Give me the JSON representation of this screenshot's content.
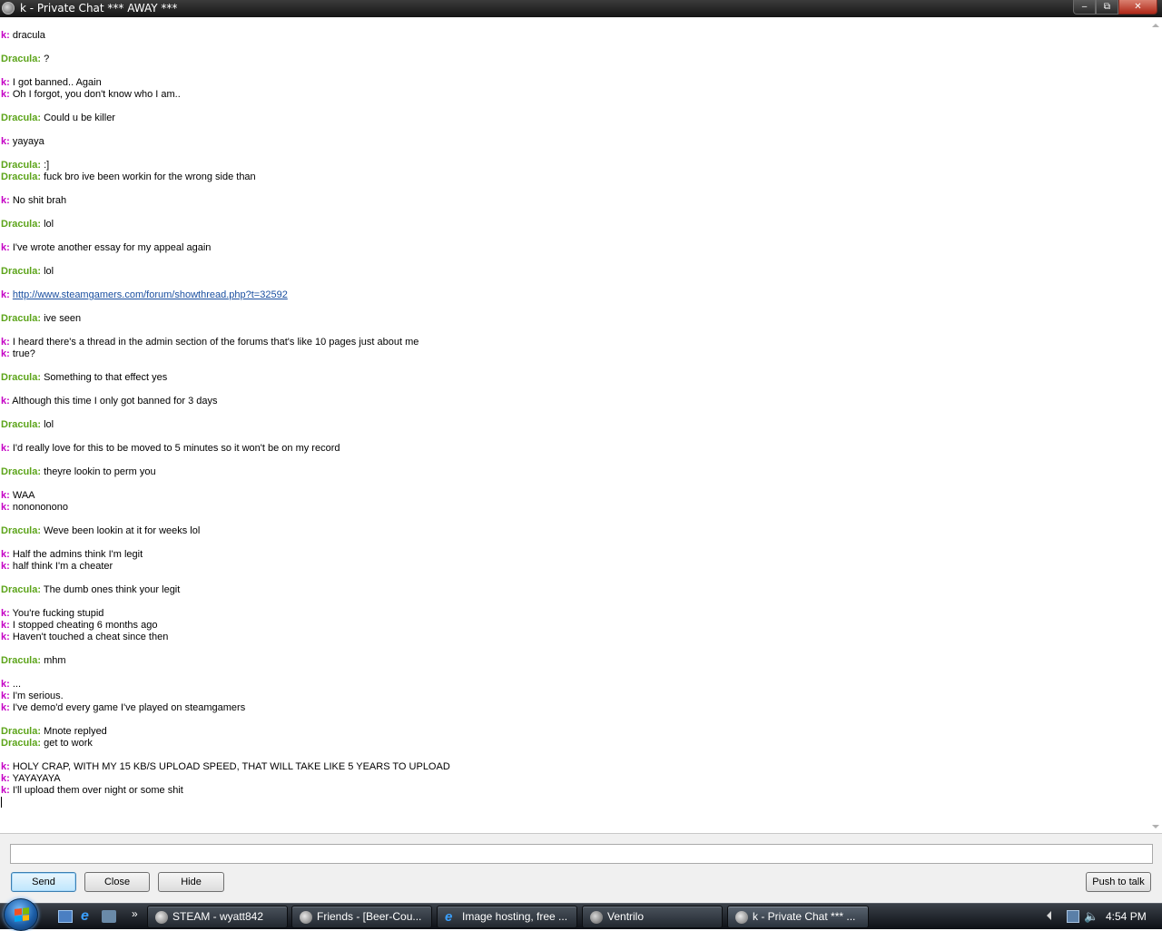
{
  "window": {
    "title": "k - Private Chat *** AWAY ***",
    "controls": {
      "minimize": "‒",
      "maximize": "⧉",
      "close": "✕"
    }
  },
  "colors": {
    "k": "#c400c4",
    "dracula": "#5ca41a",
    "link": "#1a4fa0"
  },
  "chat": {
    "messages": [
      {
        "speaker": "k:",
        "who": "k",
        "text": "dracula",
        "gap_before": false
      },
      {
        "speaker": "Dracula:",
        "who": "dracula",
        "text": "?",
        "gap_before": true
      },
      {
        "speaker": "k:",
        "who": "k",
        "text": "I got banned.. Again",
        "gap_before": true
      },
      {
        "speaker": "k:",
        "who": "k",
        "text": "Oh I forgot, you don't know who I am..",
        "gap_before": false
      },
      {
        "speaker": "Dracula:",
        "who": "dracula",
        "text": "Could u be killer",
        "gap_before": true
      },
      {
        "speaker": "k:",
        "who": "k",
        "text": "yayaya",
        "gap_before": true
      },
      {
        "speaker": "Dracula:",
        "who": "dracula",
        "text": ":]",
        "gap_before": true
      },
      {
        "speaker": "Dracula:",
        "who": "dracula",
        "text": "fuck bro ive been workin for the wrong side than",
        "gap_before": false
      },
      {
        "speaker": "k:",
        "who": "k",
        "text": "No shit brah",
        "gap_before": true
      },
      {
        "speaker": "Dracula:",
        "who": "dracula",
        "text": "lol",
        "gap_before": true
      },
      {
        "speaker": "k:",
        "who": "k",
        "text": "I've wrote another essay for my appeal again",
        "gap_before": true
      },
      {
        "speaker": "Dracula:",
        "who": "dracula",
        "text": "lol",
        "gap_before": true
      },
      {
        "speaker": "k:",
        "who": "k",
        "text": "http://www.steamgamers.com/forum/showthread.php?t=32592",
        "gap_before": true,
        "link": true
      },
      {
        "speaker": "Dracula:",
        "who": "dracula",
        "text": "ive seen",
        "gap_before": true
      },
      {
        "speaker": "k:",
        "who": "k",
        "text": "I heard there's a thread in the admin section of the forums that's like 10 pages just about me",
        "gap_before": true
      },
      {
        "speaker": "k:",
        "who": "k",
        "text": "true?",
        "gap_before": false
      },
      {
        "speaker": "Dracula:",
        "who": "dracula",
        "text": "Something to that effect yes",
        "gap_before": true
      },
      {
        "speaker": "k:",
        "who": "k",
        "text": "Although this time I only got banned for 3 days",
        "gap_before": true
      },
      {
        "speaker": "Dracula:",
        "who": "dracula",
        "text": "lol",
        "gap_before": true
      },
      {
        "speaker": "k:",
        "who": "k",
        "text": "I'd really love for this to be moved to 5 minutes so it won't be on my record",
        "gap_before": true
      },
      {
        "speaker": "Dracula:",
        "who": "dracula",
        "text": "theyre lookin to perm you",
        "gap_before": true
      },
      {
        "speaker": "k:",
        "who": "k",
        "text": "WAA",
        "gap_before": true
      },
      {
        "speaker": "k:",
        "who": "k",
        "text": "nonononono",
        "gap_before": false
      },
      {
        "speaker": "Dracula:",
        "who": "dracula",
        "text": "Weve been lookin at it for weeks lol",
        "gap_before": true
      },
      {
        "speaker": "k:",
        "who": "k",
        "text": "Half the admins think I'm legit",
        "gap_before": true
      },
      {
        "speaker": "k:",
        "who": "k",
        "text": "half think I'm a cheater",
        "gap_before": false
      },
      {
        "speaker": "Dracula:",
        "who": "dracula",
        "text": "The dumb ones think your legit",
        "gap_before": true
      },
      {
        "speaker": "k:",
        "who": "k",
        "text": "You're fucking stupid",
        "gap_before": true
      },
      {
        "speaker": "k:",
        "who": "k",
        "text": "I stopped cheating 6 months ago",
        "gap_before": false
      },
      {
        "speaker": "k:",
        "who": "k",
        "text": "Haven't touched a cheat since then",
        "gap_before": false
      },
      {
        "speaker": "Dracula:",
        "who": "dracula",
        "text": "mhm",
        "gap_before": true
      },
      {
        "speaker": "k:",
        "who": "k",
        "text": "...",
        "gap_before": true
      },
      {
        "speaker": "k:",
        "who": "k",
        "text": "I'm serious.",
        "gap_before": false
      },
      {
        "speaker": "k:",
        "who": "k",
        "text": "I've demo'd every game I've played on steamgamers",
        "gap_before": false
      },
      {
        "speaker": "Dracula:",
        "who": "dracula",
        "text": "Mnote replyed",
        "gap_before": true
      },
      {
        "speaker": "Dracula:",
        "who": "dracula",
        "text": "get to work",
        "gap_before": false
      },
      {
        "speaker": "k:",
        "who": "k",
        "text": "HOLY CRAP, WITH MY 15 KB/S UPLOAD SPEED, THAT WILL TAKE LIKE 5 YEARS TO UPLOAD",
        "gap_before": true
      },
      {
        "speaker": "k:",
        "who": "k",
        "text": "YAYAYAYA",
        "gap_before": false
      },
      {
        "speaker": "k:",
        "who": "k",
        "text": "I'll upload them over night or some shit",
        "gap_before": false
      }
    ]
  },
  "composer": {
    "value": "",
    "placeholder": ""
  },
  "buttons": {
    "send": "Send",
    "close": "Close",
    "hide": "Hide",
    "push_to_talk": "Push to talk"
  },
  "taskbar": {
    "quicklaunch_more": "»",
    "tasks": [
      {
        "label": "STEAM - wyatt842",
        "icon": "steam-icon",
        "active": false
      },
      {
        "label": "Friends - [Beer-Cou...",
        "icon": "steam-icon",
        "active": false
      },
      {
        "label": "Image hosting, free ...",
        "icon": "ie-icon",
        "active": false
      },
      {
        "label": "Ventrilo",
        "icon": "ventrilo-icon",
        "active": false
      },
      {
        "label": "k - Private Chat *** ...",
        "icon": "steam-icon",
        "active": true
      }
    ],
    "clock": "4:54 PM",
    "volume_glyph": "🔈"
  }
}
